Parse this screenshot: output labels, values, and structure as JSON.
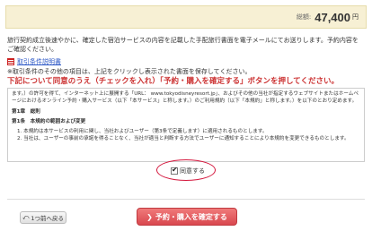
{
  "total": {
    "label": "総額:",
    "amount": "47,400",
    "unit": "円"
  },
  "notice": "旅行契約成立後速やかに、確定した宿泊サービスの内容を記載した手配旅行書面を電子メールにてお送りします。予約内容をご確認ください。",
  "terms_link": {
    "icon": "pdf-icon",
    "label": "取引条件説明書"
  },
  "terms_note": "※取引条件のその他の項目は、上記をクリックし表示された書面を保存してください。",
  "instruction": "下記について同意のうえ（チェックを入れ）「予約・購入を確定する」ボタンを押してください。",
  "terms_box": {
    "intro": "ます。）の許可を得て、インターネット上に展開する「URL： www.tokyodisneyresort.jp」、およびその他の当社が指定するウェブサイトまたはホームページにおけるオンライン予約・購入サービス（以下「本サービス」と称します。）のご利用規約（以下「本規約」と称します。）を以下のとおり定めます。",
    "chapter": "第1章　総則",
    "article": "第1条　本規約の範囲および変更",
    "items": [
      "1. 本規約は本サービスの利用に関し、当社およびユーザー（第3条で定義します）に適用されるものとします。",
      "2. 当社は、ユーザーの事前の承諾を得ることなく、当社が適当と判断する方法でユーザーに通知することにより本規約を変更できるものとします。"
    ]
  },
  "agree_label": "同意する",
  "buttons": {
    "back": "1つ前へ戻る",
    "confirm": "予約・購入を確定する"
  }
}
